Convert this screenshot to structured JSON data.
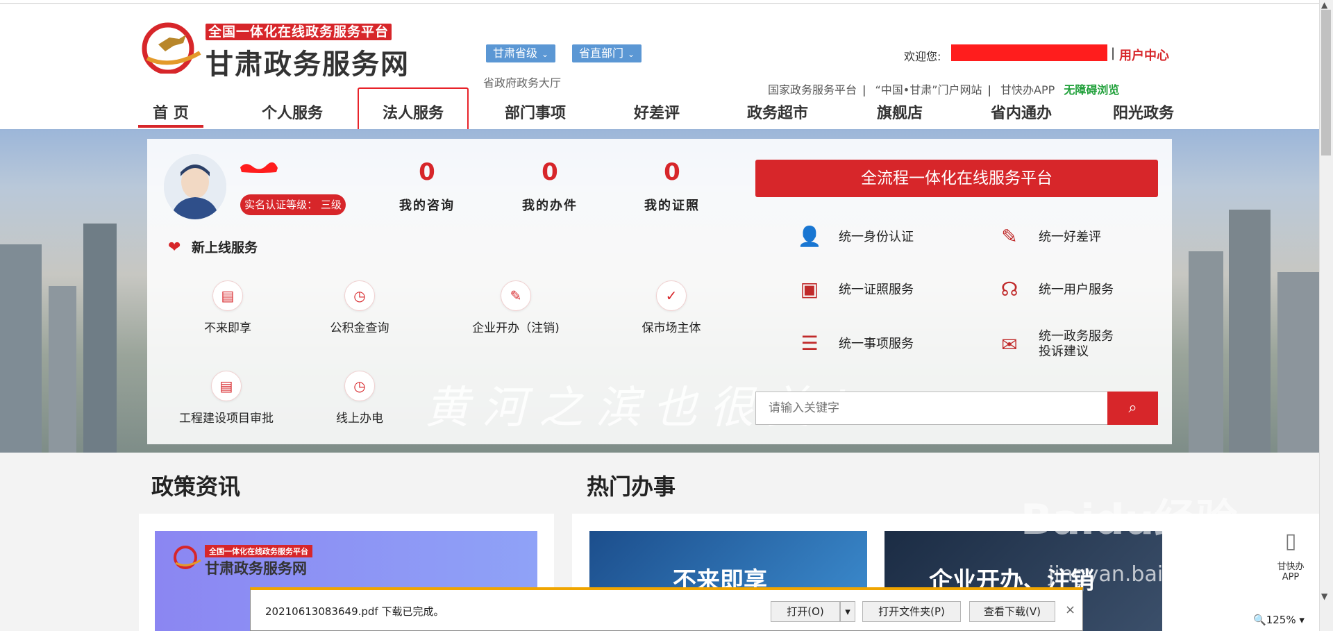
{
  "site": {
    "badge": "全国一体化在线政务服务平台",
    "title": "甘肃政务服务网",
    "region_dropdown": "甘肃省级",
    "dept_dropdown": "省直部门",
    "hall": "省政府政务大厅",
    "welcome": "欢迎您:",
    "user_center": "用户中心",
    "top_links": [
      "国家政务服务平台",
      "“中国•甘肃”门户网站",
      "甘快办APP"
    ],
    "accessible": "无障碍浏览"
  },
  "nav": [
    "首 页",
    "个人服务",
    "法人服务",
    "部门事项",
    "好差评",
    "政务超市",
    "旗舰店",
    "省内通办",
    "阳光政务"
  ],
  "profile": {
    "cert_level": "实名认证等级：  三级",
    "stats": [
      {
        "value": "0",
        "label": "我的咨询"
      },
      {
        "value": "0",
        "label": "我的办件"
      },
      {
        "value": "0",
        "label": "我的证照"
      }
    ],
    "new_services_title": "新上线服务",
    "services": [
      "不来即享",
      "公积金查询",
      "企业开办（注销)",
      "保市场主体",
      "工程建设项目审批",
      "线上办电"
    ]
  },
  "platform_button": "全流程一体化在线服务平台",
  "quick": [
    {
      "label": "统一身份认证",
      "icon": "user-icon"
    },
    {
      "label": "统一好差评",
      "icon": "edit-icon"
    },
    {
      "label": "统一证照服务",
      "icon": "id-card-icon"
    },
    {
      "label": "统一用户服务",
      "icon": "headset-icon"
    },
    {
      "label": "统一事项服务",
      "icon": "list-icon"
    },
    {
      "label": "统一政务服务\n投诉建议",
      "icon": "mail-icon"
    }
  ],
  "search": {
    "placeholder": "请输入关键字"
  },
  "slogan": "黄河之滨也很美！",
  "sections": {
    "policy": "政策资讯",
    "hot": "热门办事"
  },
  "cards": {
    "hot1": "不来即享",
    "hot2": "企业开办、注销",
    "policy_badge": "全国一体化在线政务服务平台",
    "policy_title": "甘肃政务服务网"
  },
  "download": {
    "message": "20210613083649.pdf 下载已完成。",
    "open": "打开(O)",
    "open_folder": "打开文件夹(P)",
    "view_downloads": "查看下载(V)"
  },
  "app_float": {
    "label1": "甘快办",
    "label2": "APP"
  },
  "zoom": "125%",
  "watermark": "Baidu经验",
  "watermark_url": "jingyan.baidu.com",
  "colors": {
    "brand_red": "#d7262a",
    "dropdown_blue": "#5b97d4",
    "accessible_green": "#20a03a"
  }
}
